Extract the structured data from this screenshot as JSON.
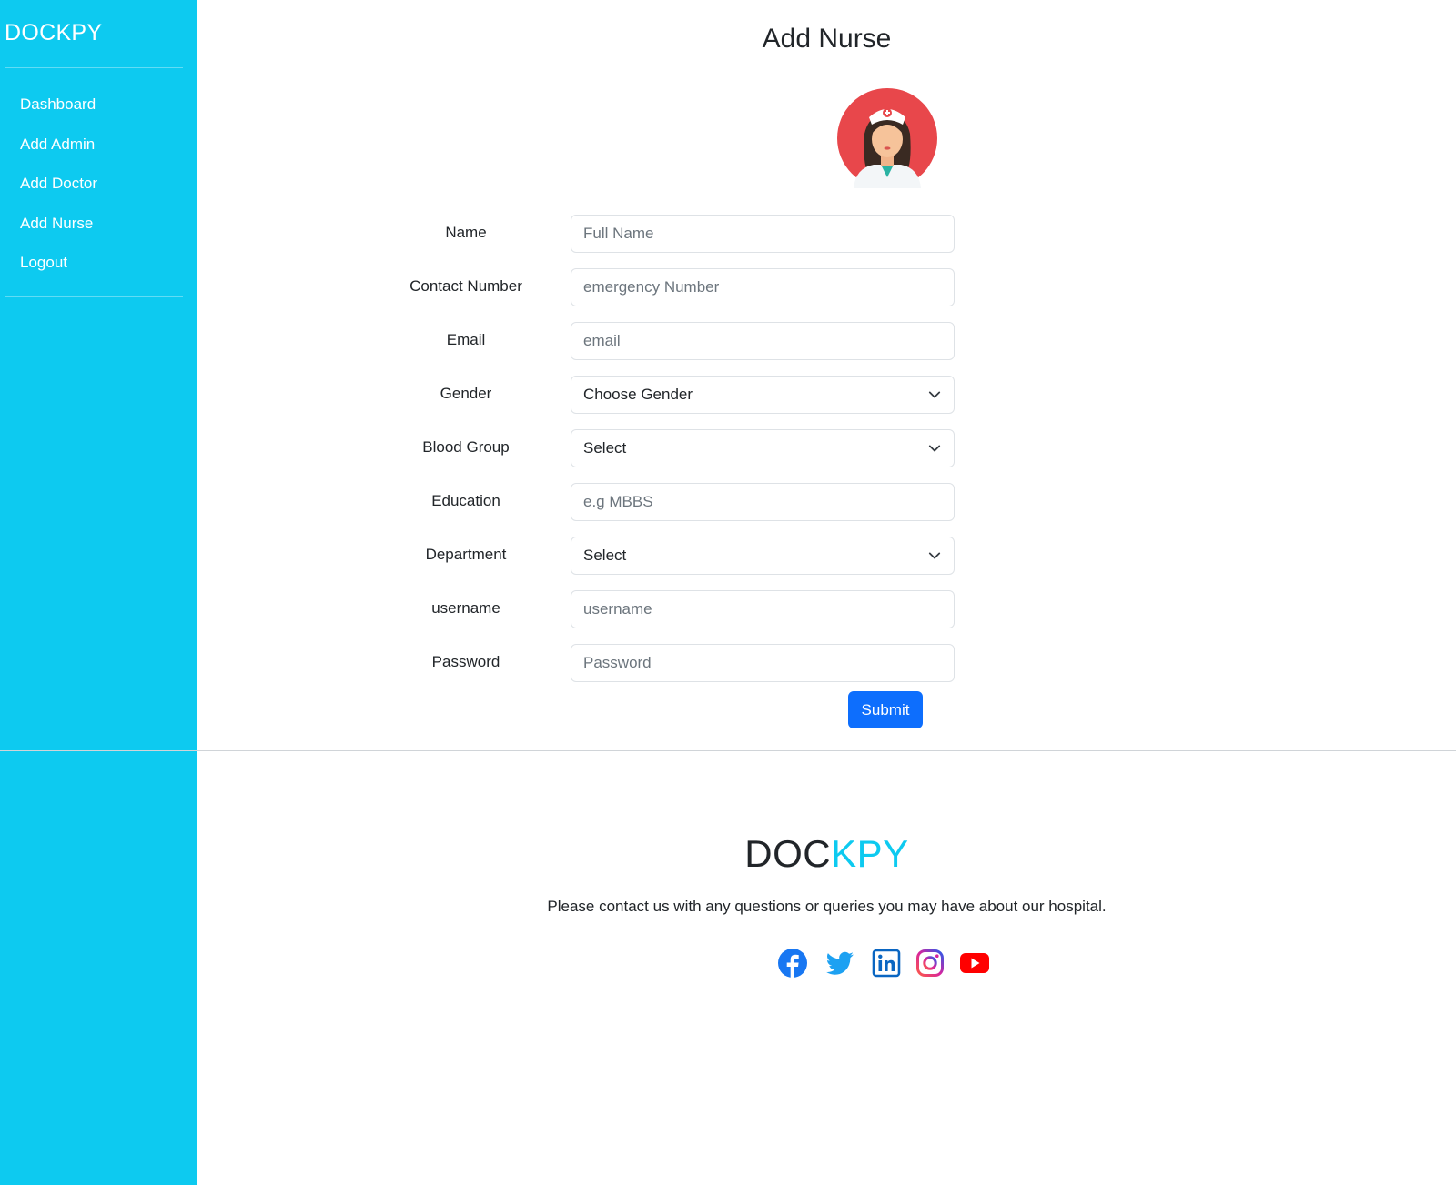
{
  "sidebar": {
    "brand": "DOCKPY",
    "items": [
      {
        "label": "Dashboard"
      },
      {
        "label": "Add Admin"
      },
      {
        "label": "Add Doctor"
      },
      {
        "label": "Add Nurse"
      },
      {
        "label": "Logout"
      }
    ]
  },
  "form": {
    "title": "Add Nurse",
    "fields": {
      "name": {
        "label": "Name",
        "placeholder": "Full Name"
      },
      "contact": {
        "label": "Contact Number",
        "placeholder": "emergency Number"
      },
      "email": {
        "label": "Email",
        "placeholder": "email"
      },
      "gender": {
        "label": "Gender",
        "value": "Choose Gender"
      },
      "blood": {
        "label": "Blood Group",
        "value": "Select"
      },
      "education": {
        "label": "Education",
        "placeholder": "e.g MBBS"
      },
      "department": {
        "label": "Department",
        "value": "Select"
      },
      "username": {
        "label": "username",
        "placeholder": "username"
      },
      "password": {
        "label": "Password",
        "placeholder": "Password"
      }
    },
    "submit_label": "Submit"
  },
  "footer": {
    "brand_dark": "DOC",
    "brand_blue": "KPY",
    "text": "Please contact us with any questions or queries you may have about our hospital.",
    "socials": [
      "facebook-icon",
      "twitter-icon",
      "linkedin-icon",
      "instagram-icon",
      "youtube-icon"
    ]
  },
  "colors": {
    "sidebar": "#0dcaf0",
    "primary": "#0d6efd",
    "brand_blue": "#0dcaf0",
    "facebook": "#1877f2",
    "twitter": "#1da1f2",
    "linkedin": "#0a66c2",
    "instagram": "#d6249f",
    "youtube": "#ff0000"
  }
}
